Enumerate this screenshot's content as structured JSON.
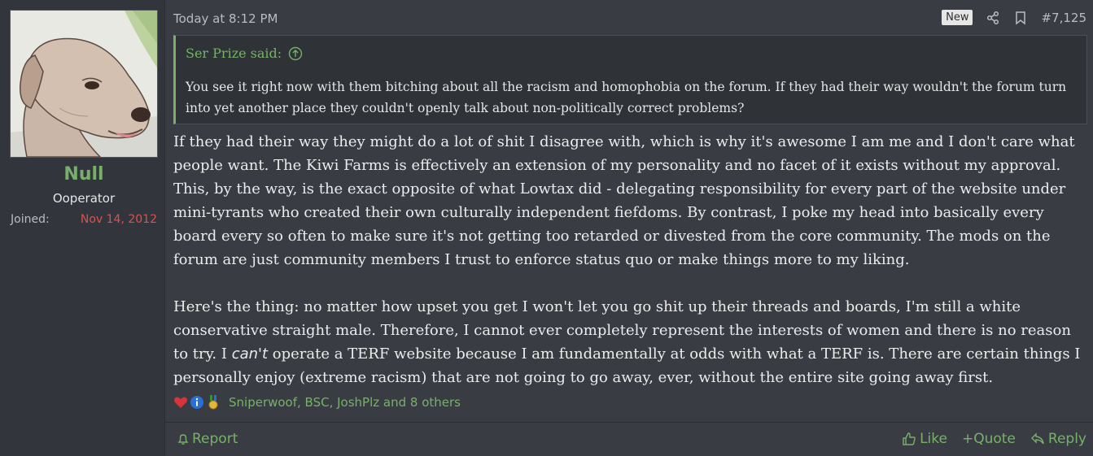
{
  "user": {
    "name": "Null",
    "title": "Ooperator",
    "joined_label": "Joined:",
    "joined_date": "Nov 14, 2012",
    "avatar_icon": "dog-avatar"
  },
  "post": {
    "date": "Today at 8:12 PM",
    "badge": "New",
    "number": "#7,125",
    "share_icon": "share-icon",
    "bookmark_icon": "bookmark-icon"
  },
  "quote": {
    "author": "Ser Prize said:",
    "text": "You see it right now with them bitching about all the racism and homophobia on the forum. If they had their way wouldn't the forum turn into yet another place they couldn't openly talk about non-politically correct problems?"
  },
  "content": {
    "p1": "If they had their way they might do a lot of shit I disagree with, which is why it's awesome I am me and I don't care what people want. The Kiwi Farms is effectively an extension of my personality and no facet of it exists without my approval. This, by the way, is the exact opposite of what Lowtax did - delegating responsibility for every part of the website under mini-tyrants who created their own culturally independent fiefdoms. By contrast, I poke my head into basically every board every so often to make sure it's not getting too retarded or divested from the core community. The mods on the forum are just community members I trust to enforce status quo or make things more to my liking.",
    "p2_before": "Here's the thing: no matter how upset you get I won't let you go shit up their threads and boards, I'm still a white conservative straight male. Therefore, I cannot ever completely represent the interests of women and there is no reason to try. I ",
    "p2_em": "can't",
    "p2_after": " operate a TERF website because I am fundamentally at odds with what a TERF is. There are certain things I personally enjoy (extreme racism) that are not going to go away, ever, without the entire site going away first."
  },
  "reactions": {
    "text": "Sniperwoof, BSC, JoshPlz and 8 others",
    "icons": [
      "heart-icon",
      "info-icon",
      "medal-icon"
    ]
  },
  "footer": {
    "report": "Report",
    "like": "Like",
    "quote": "+Quote",
    "reply": "Reply"
  },
  "colors": {
    "accent": "#78b06a",
    "date_red": "#d9534f",
    "background": "#393c43",
    "sidebar": "#32353b"
  }
}
